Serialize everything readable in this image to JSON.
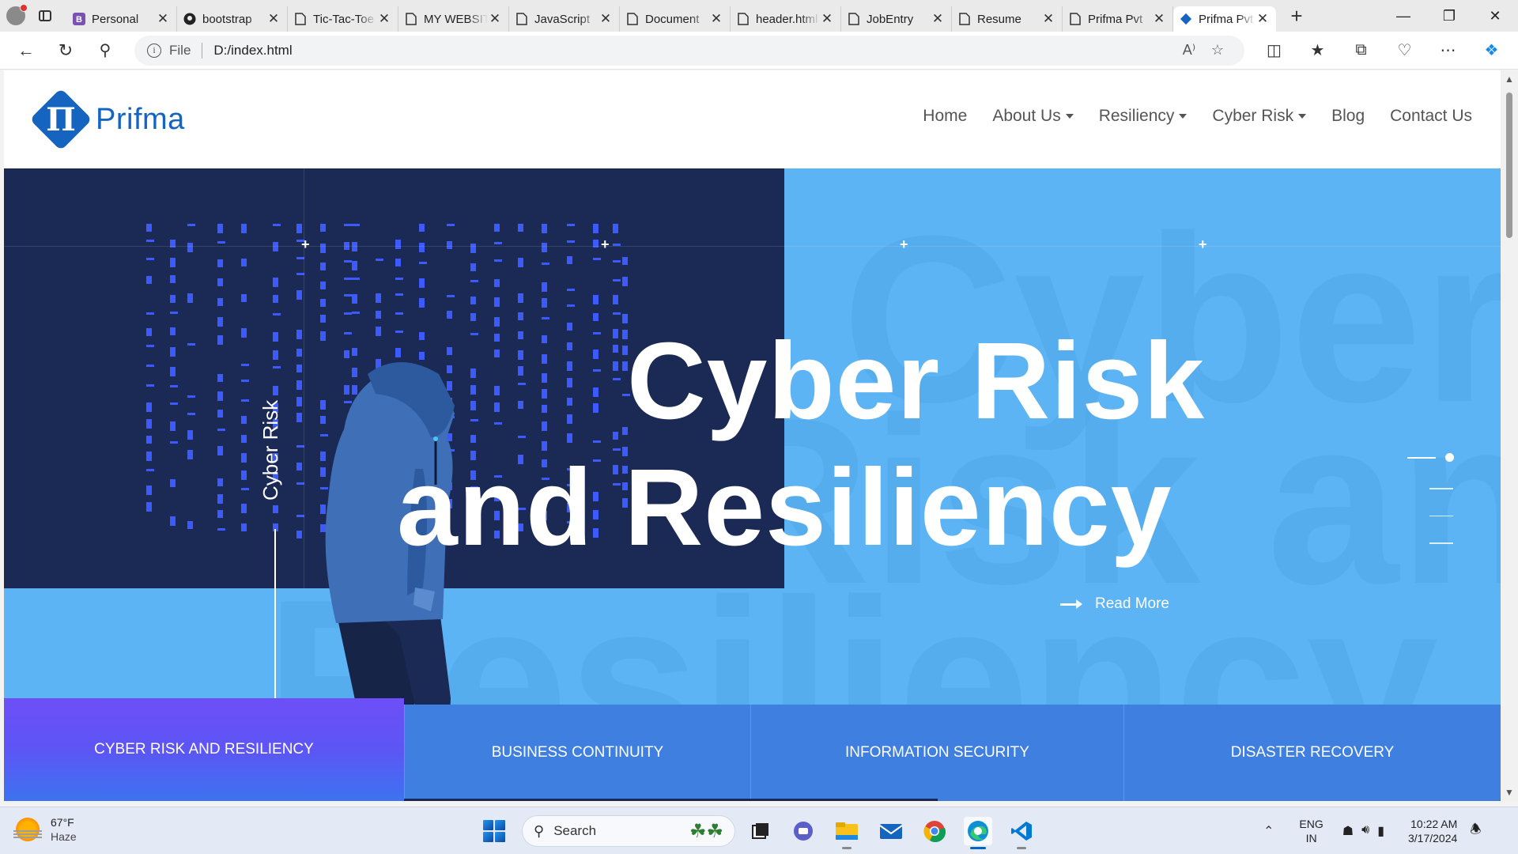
{
  "browser": {
    "tabs": [
      {
        "title": "Personal",
        "icon": "bootstrap-favicon"
      },
      {
        "title": "bootstrap",
        "icon": "github-favicon"
      },
      {
        "title": "Tic-Tac-Toe",
        "icon": "page-icon"
      },
      {
        "title": "MY WEBSITE",
        "icon": "page-icon"
      },
      {
        "title": "JavaScript",
        "icon": "page-icon"
      },
      {
        "title": "Document",
        "icon": "page-icon"
      },
      {
        "title": "header.html",
        "icon": "page-icon"
      },
      {
        "title": "JobEntry",
        "icon": "page-icon"
      },
      {
        "title": "Resume",
        "icon": "page-icon"
      },
      {
        "title": "Prifma Pvt",
        "icon": "page-icon"
      },
      {
        "title": "Prifma Pvt",
        "icon": "prifma-favicon",
        "active": true
      }
    ],
    "address": {
      "scheme_label": "File",
      "url": "D:/index.html"
    }
  },
  "site": {
    "brand": "Prifma",
    "brand_mark": "Π",
    "brand_color": "#1565c0",
    "nav": [
      {
        "label": "Home",
        "dropdown": false
      },
      {
        "label": "About Us",
        "dropdown": true
      },
      {
        "label": "Resiliency",
        "dropdown": true
      },
      {
        "label": "Cyber Risk",
        "dropdown": true
      },
      {
        "label": "Blog",
        "dropdown": false
      },
      {
        "label": "Contact Us",
        "dropdown": false
      }
    ]
  },
  "hero": {
    "side_label": "Cyber Risk",
    "headline_line1": "Cyber Risk",
    "headline_line2": "and Resiliency",
    "ghost_line1": "Cyber",
    "ghost_line2": "Risk and",
    "ghost_line3": "Resiliency",
    "read_more": "Read More",
    "slide_count": 4,
    "active_slide": 1,
    "colors": {
      "dark_panel": "#1a2a55",
      "sky": "#5db4f4",
      "matrix": "#3d5afe"
    }
  },
  "services": [
    {
      "label": "CYBER RISK AND RESILIENCY",
      "active": true
    },
    {
      "label": "BUSINESS CONTINUITY",
      "active": false
    },
    {
      "label": "INFORMATION SECURITY",
      "active": false
    },
    {
      "label": "DISASTER RECOVERY",
      "active": false
    }
  ],
  "taskbar": {
    "weather_temp": "67°F",
    "weather_cond": "Haze",
    "search_placeholder": "Search",
    "apps": [
      "task-view",
      "teams",
      "file-explorer",
      "mail",
      "chrome",
      "edge",
      "vscode"
    ],
    "lang_line1": "ENG",
    "lang_line2": "IN",
    "time": "10:22 AM",
    "date": "3/17/2024"
  }
}
